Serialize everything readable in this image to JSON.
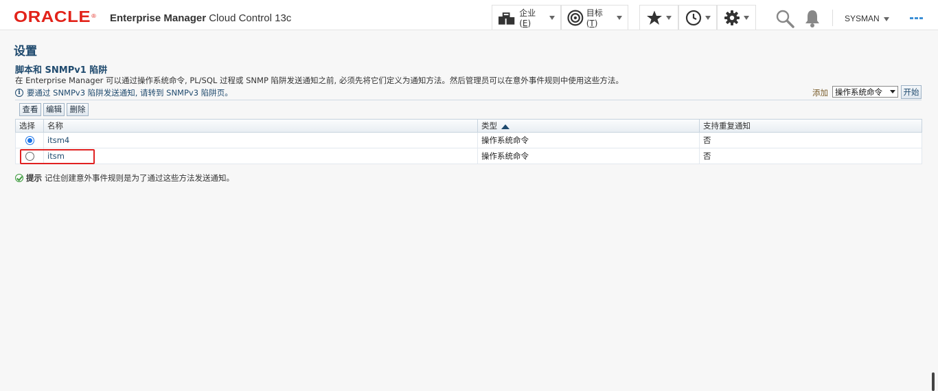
{
  "header": {
    "logo": "ORACLE",
    "logo_mark": "®",
    "product_bold": "Enterprise Manager",
    "product_rest": " Cloud Control 13c",
    "menus": [
      {
        "label": "企业",
        "accesskey": "E"
      },
      {
        "label": "目标",
        "accesskey": "T"
      }
    ],
    "user": "SYSMAN"
  },
  "page": {
    "title": "设置",
    "section_title": "脚本和 SNMPv1 陷阱",
    "description": "在 Enterprise Manager 可以通过操作系统命令, PL/SQL 过程或 SNMP 陷阱发送通知之前, 必须先将它们定义为通知方法。然后管理员可以在意外事件规则中使用这些方法。",
    "info": "要通过 SNMPv3 陷阱发送通知, 请转到 SNMPv3 陷阱页。",
    "add_label": "添加",
    "add_select_value": "操作系统命令",
    "start_button": "开始",
    "toolbar": {
      "view": "查看",
      "edit": "编辑",
      "delete": "删除"
    },
    "table": {
      "headers": {
        "select": "选择",
        "name": "名称",
        "type": "类型",
        "repeat": "支持重复通知"
      },
      "sorted_column": "类型",
      "rows": [
        {
          "name": "itsm4",
          "type": "操作系统命令",
          "repeat": "否",
          "selected": true
        },
        {
          "name": "itsm",
          "type": "操作系统命令",
          "repeat": "否",
          "selected": false
        }
      ]
    },
    "tip_label": "提示",
    "tip_text": "记住创建意外事件规则是为了通过这些方法发送通知。"
  },
  "colors": {
    "brand": "#e2231a",
    "heading": "#1f4a6e",
    "highlight": "#e02020",
    "radio_selected": "#1a73e8"
  },
  "icons": [
    "enterprise-icon",
    "target-icon",
    "star-icon",
    "history-icon",
    "gear-icon",
    "search-icon",
    "bell-icon",
    "menu-dots-icon",
    "info-icon",
    "check-circle-icon",
    "sort-ascending-icon"
  ]
}
